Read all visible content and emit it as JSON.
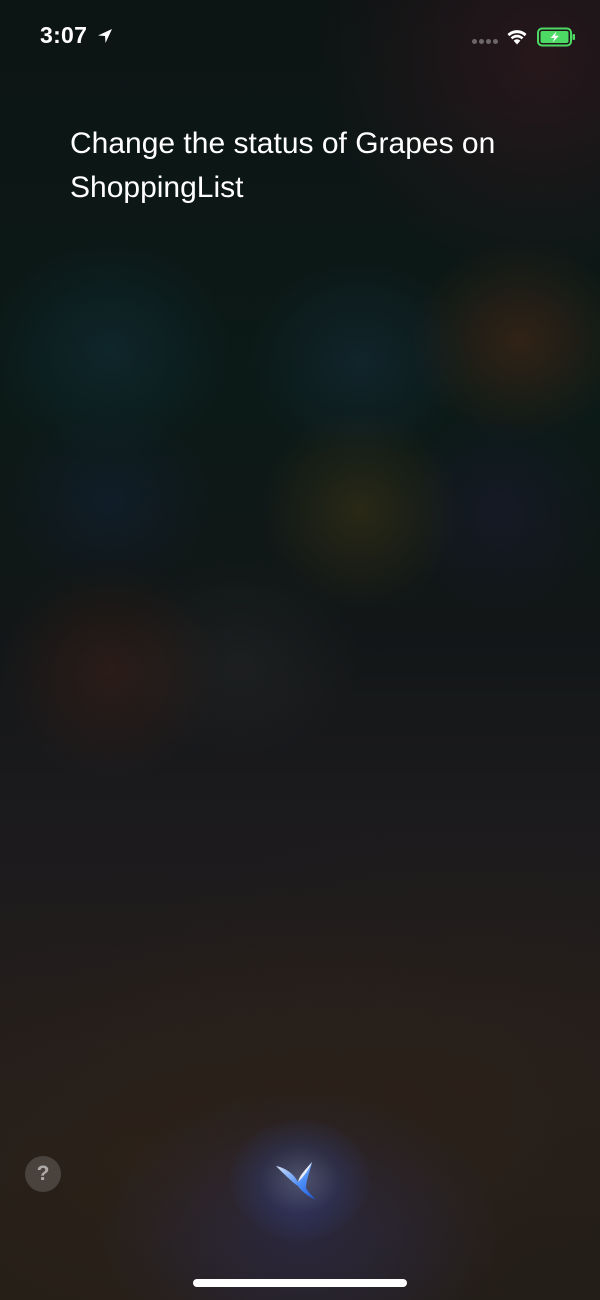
{
  "status_bar": {
    "time": "3:07",
    "location_icon": "location-arrow-icon",
    "wifi_icon": "wifi-icon",
    "battery_icon": "battery-charging-icon",
    "battery_color": "#4cd964"
  },
  "siri": {
    "query": "Change the status of Grapes on ShoppingList",
    "help_label": "?",
    "orb_color": "#4a90ff"
  }
}
